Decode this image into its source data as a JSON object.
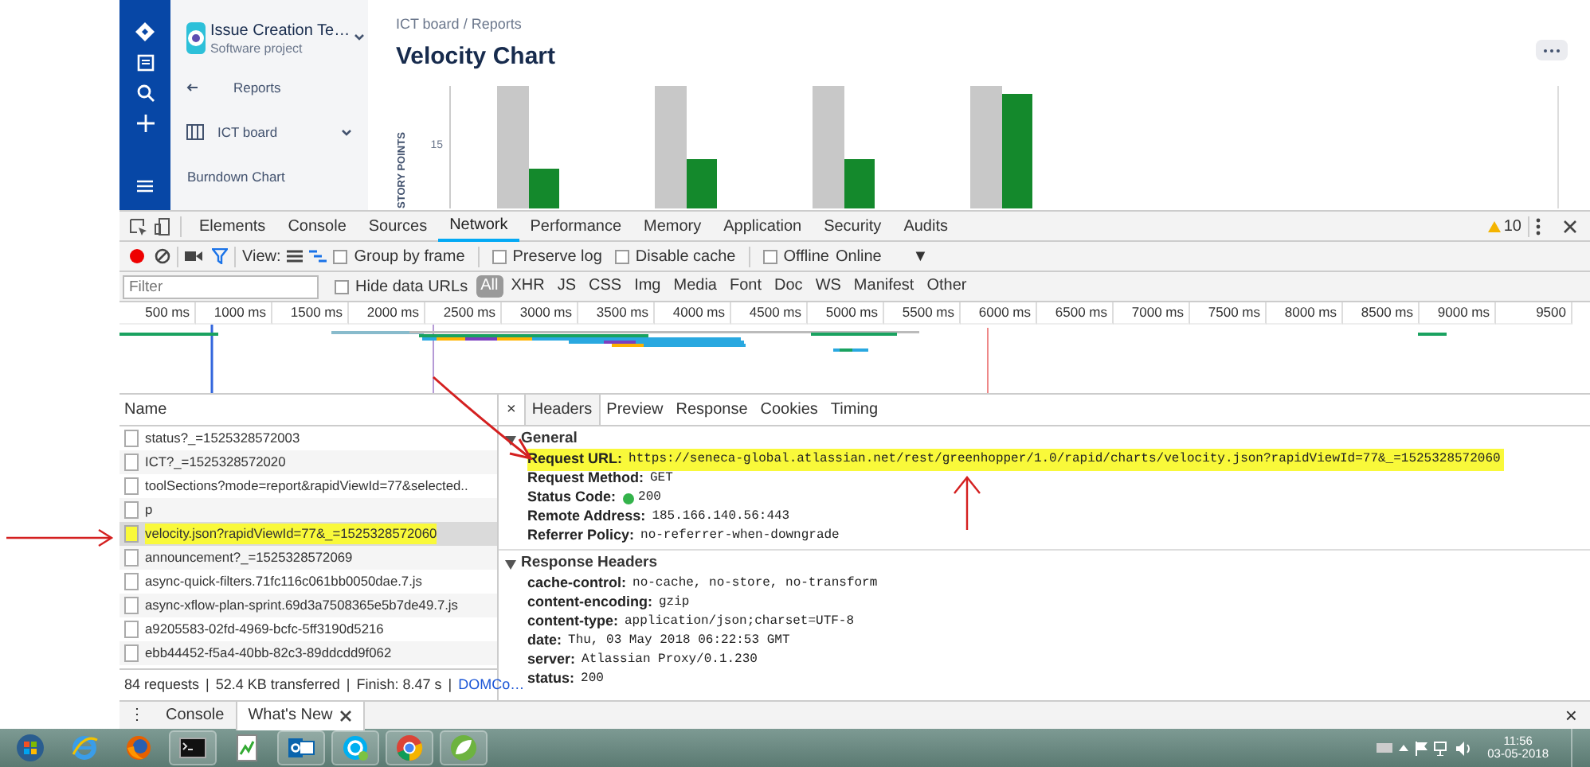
{
  "jira": {
    "project": {
      "name": "Issue Creation Te…",
      "type": "Software project"
    },
    "sidebar": {
      "items": [
        {
          "kind": "back",
          "label": "Reports"
        },
        {
          "kind": "board",
          "label": "ICT board"
        },
        {
          "kind": "link",
          "label": "Burndown Chart"
        }
      ]
    },
    "breadcrumbs": {
      "items": [
        "ICT board",
        "Reports"
      ],
      "separator": "/"
    },
    "title": "Velocity Chart",
    "chart": {
      "ylabel": "STORY POINTS",
      "tick": "15"
    }
  },
  "devtools": {
    "tabs": [
      {
        "label": "Elements",
        "selected": false
      },
      {
        "label": "Console",
        "selected": false
      },
      {
        "label": "Sources",
        "selected": false
      },
      {
        "label": "Network",
        "selected": true
      },
      {
        "label": "Performance",
        "selected": false
      },
      {
        "label": "Memory",
        "selected": false
      },
      {
        "label": "Application",
        "selected": false
      },
      {
        "label": "Security",
        "selected": false
      },
      {
        "label": "Audits",
        "selected": false
      }
    ],
    "warnings": "10",
    "toolbar": {
      "view_label": "View:",
      "options": [
        {
          "label": "Group by frame",
          "checked": false
        },
        {
          "label": "Preserve log",
          "checked": false
        },
        {
          "label": "Disable cache",
          "checked": false
        },
        {
          "label": "Offline",
          "checked": false
        }
      ],
      "throttling": "Online",
      "caret": "▼"
    },
    "filter": {
      "placeholder": "Filter",
      "hide_data_urls": {
        "label": "Hide data URLs",
        "checked": false
      },
      "types": [
        {
          "label": "All",
          "selected": true
        },
        {
          "label": "XHR",
          "selected": false
        },
        {
          "label": "JS",
          "selected": false
        },
        {
          "label": "CSS",
          "selected": false
        },
        {
          "label": "Img",
          "selected": false
        },
        {
          "label": "Media",
          "selected": false
        },
        {
          "label": "Font",
          "selected": false
        },
        {
          "label": "Doc",
          "selected": false
        },
        {
          "label": "WS",
          "selected": false
        },
        {
          "label": "Manifest",
          "selected": false
        },
        {
          "label": "Other",
          "selected": false
        }
      ]
    },
    "timeline": {
      "ticks": [
        "500 ms",
        "1000 ms",
        "1500 ms",
        "2000 ms",
        "2500 ms",
        "3000 ms",
        "3500 ms",
        "4000 ms",
        "4500 ms",
        "5000 ms",
        "5500 ms",
        "6000 ms",
        "6500 ms",
        "7000 ms",
        "7500 ms",
        "8000 ms",
        "8500 ms",
        "9000 ms",
        "9500"
      ]
    },
    "requests": {
      "column": "Name",
      "rows": [
        {
          "name": "status?_=1525328572003",
          "selected": false,
          "highlighted": false
        },
        {
          "name": "ICT?_=1525328572020",
          "selected": false,
          "highlighted": false
        },
        {
          "name": "toolSections?mode=report&rapidViewId=77&selected..",
          "selected": false,
          "highlighted": false
        },
        {
          "name": "p",
          "selected": false,
          "highlighted": false
        },
        {
          "name": "velocity.json?rapidViewId=77&_=1525328572060",
          "selected": true,
          "highlighted": true
        },
        {
          "name": "announcement?_=1525328572069",
          "selected": false,
          "highlighted": false
        },
        {
          "name": "async-quick-filters.71fc116c061bb0050dae.7.js",
          "selected": false,
          "highlighted": false
        },
        {
          "name": "async-xflow-plan-sprint.69d3a7508365e5b7de49.7.js",
          "selected": false,
          "highlighted": false
        },
        {
          "name": "a9205583-02fd-4969-bcfc-5ff3190d5216",
          "selected": false,
          "highlighted": false
        },
        {
          "name": "ebb44452-f5a4-40bb-82c3-89ddcdd9f062",
          "selected": false,
          "highlighted": false
        }
      ],
      "summary": [
        "84 requests",
        "52.4 KB transferred",
        "Finish: 8.47 s"
      ],
      "separator": "|",
      "dom": "DOMCo…"
    },
    "details": {
      "close": "×",
      "tabs": [
        {
          "label": "Headers",
          "selected": true
        },
        {
          "label": "Preview",
          "selected": false
        },
        {
          "label": "Response",
          "selected": false
        },
        {
          "label": "Cookies",
          "selected": false
        },
        {
          "label": "Timing",
          "selected": false
        }
      ],
      "sections": [
        {
          "title": "General",
          "expanded": true,
          "rows": [
            {
              "kind": "text",
              "key": "Request URL:",
              "value": "https://seneca-global.atlassian.net/rest/greenhopper/1.0/rapid/charts/velocity.json?rapidViewId=77&_=1525328572060",
              "highlighted": true
            },
            {
              "kind": "text",
              "key": "Request Method:",
              "value": "GET",
              "highlighted": false
            },
            {
              "kind": "status",
              "key": "Status Code:",
              "value": "200",
              "highlighted": false
            },
            {
              "kind": "text",
              "key": "Remote Address:",
              "value": "185.166.140.56:443",
              "highlighted": false
            },
            {
              "kind": "text",
              "key": "Referrer Policy:",
              "value": "no-referrer-when-downgrade",
              "highlighted": false
            }
          ]
        },
        {
          "title": "Response Headers",
          "expanded": true,
          "rows": [
            {
              "kind": "text",
              "key": "cache-control:",
              "value": "no-cache, no-store, no-transform",
              "highlighted": false
            },
            {
              "kind": "text",
              "key": "content-encoding:",
              "value": "gzip",
              "highlighted": false
            },
            {
              "kind": "text",
              "key": "content-type:",
              "value": "application/json;charset=UTF-8",
              "highlighted": false
            },
            {
              "kind": "text",
              "key": "date:",
              "value": "Thu, 03 May 2018 06:22:53 GMT",
              "highlighted": false
            },
            {
              "kind": "text",
              "key": "server:",
              "value": "Atlassian Proxy/0.1.230",
              "highlighted": false
            },
            {
              "kind": "text",
              "key": "status:",
              "value": "200",
              "highlighted": false
            }
          ]
        }
      ]
    },
    "drawer": {
      "menu": "⋮",
      "tabs": [
        {
          "label": "Console",
          "selected": false,
          "closable": false
        },
        {
          "label": "What's New",
          "selected": true,
          "closable": true
        }
      ],
      "close": "×"
    }
  },
  "taskbar": {
    "time": "11:56",
    "date": "03-05-2018"
  }
}
